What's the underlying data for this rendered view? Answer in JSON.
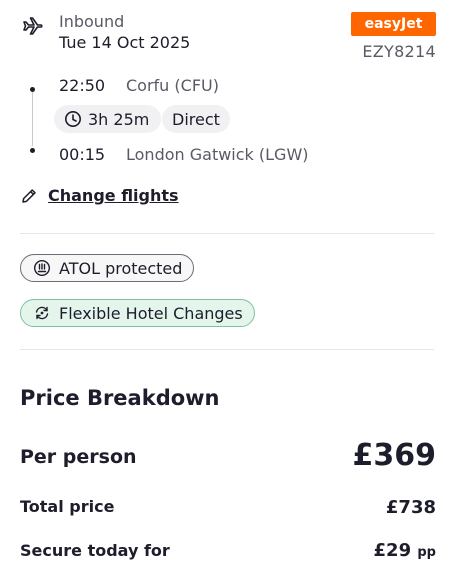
{
  "flight": {
    "direction": "Inbound",
    "date": "Tue 14 Oct 2025",
    "airline": "easyJet",
    "flight_number": "EZY8214",
    "departure": {
      "time": "22:50",
      "place": "Corfu (CFU)"
    },
    "duration": "3h 25m",
    "stops": "Direct",
    "arrival": {
      "time": "00:15",
      "place": "London Gatwick (LGW)"
    },
    "change_label": "Change flights"
  },
  "badges": {
    "atol": "ATOL protected",
    "flexible": "Flexible Hotel Changes"
  },
  "price": {
    "title": "Price Breakdown",
    "per_person_label": "Per person",
    "per_person_value": "£369",
    "total_label": "Total price",
    "total_value": "£738",
    "secure_label": "Secure today for",
    "secure_value": "£29",
    "secure_suffix": "pp"
  },
  "colors": {
    "airline_brand": "#ff6600",
    "flex_badge_bg": "#e4f5ec",
    "flex_badge_border": "#7fc2a0"
  }
}
